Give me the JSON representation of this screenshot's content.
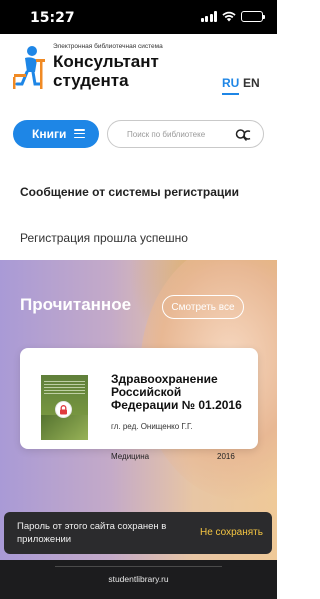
{
  "status_bar": {
    "time": "15:27",
    "icons": [
      "signal-icon",
      "wifi-icon",
      "battery-icon"
    ]
  },
  "header": {
    "logo_caption": "Электронная библиотечная система",
    "logo_title_line1": "Консультант",
    "logo_title_line2": "студента",
    "languages": [
      "RU",
      "EN"
    ],
    "active_language": "RU"
  },
  "search": {
    "books_button_label": "Книги",
    "placeholder": "Поиск по библиотеке"
  },
  "message": {
    "title": "Сообщение от системы регистрации",
    "text": "Регистрация прошла успешно"
  },
  "read_section": {
    "title": "Прочитанное",
    "see_all_label": "Смотреть все",
    "books": [
      {
        "title": "Здравоохранение Российской Федерации № 01.2016",
        "author": "гл. ред. Онищенко Г.Г.",
        "category": "Медицина",
        "year": "2016",
        "locked": true
      }
    ]
  },
  "toast": {
    "message": "Пароль от этого сайта сохранен в приложении",
    "action_label": "Не сохранять"
  },
  "browser": {
    "url": "studentlibrary.ru"
  },
  "colors": {
    "accent": "#1e86e6",
    "toast_action": "#f4c542",
    "lock": "#e0393e"
  }
}
